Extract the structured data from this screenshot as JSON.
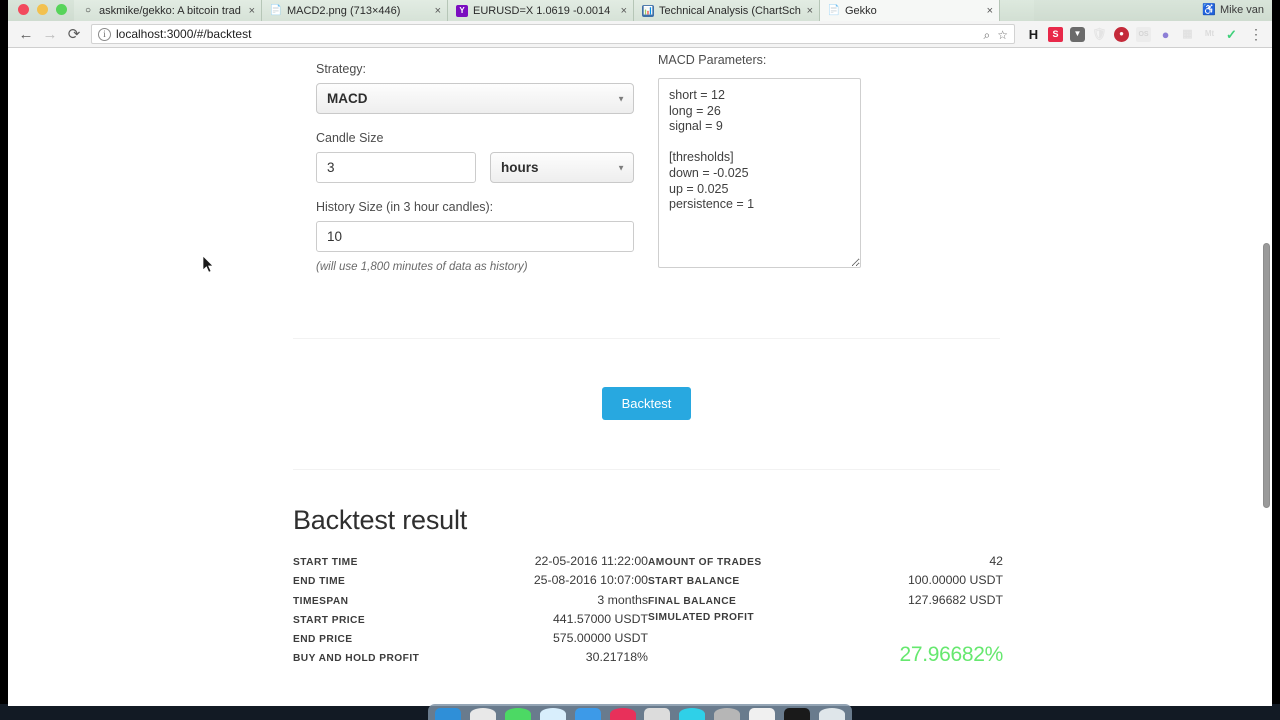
{
  "browser": {
    "window_controls": [
      "close",
      "minimize",
      "zoom"
    ],
    "tabs": [
      {
        "title": "askmike/gekko: A bitcoin trad",
        "favicon": "github-icon",
        "active": false,
        "close_label": "×"
      },
      {
        "title": "MACD2.png (713×446)",
        "favicon": "file-icon",
        "active": false,
        "close_label": "×"
      },
      {
        "title": "EURUSD=X 1.0619 -0.0014",
        "favicon": "yahoo-icon",
        "active": false,
        "close_label": "×"
      },
      {
        "title": "Technical Analysis (ChartScho",
        "favicon": "chart-icon",
        "active": false,
        "close_label": "×"
      },
      {
        "title": "Gekko",
        "favicon": "file-icon",
        "active": true,
        "close_label": "×"
      }
    ],
    "new_tab_label": "+",
    "user": {
      "name": "Mike van",
      "icon": "user-badge-icon"
    },
    "nav": {
      "back": "←",
      "forward": "→",
      "reload": "⟳"
    },
    "omnibox": {
      "info_icon": "i",
      "url": "localhost:3000/#/backtest",
      "zoom_icon": "⌕",
      "bookmark_icon": "☆"
    },
    "extensions": [
      {
        "name": "honey-extension",
        "glyph": "H",
        "color": "#1c1c1c",
        "bg": "transparent",
        "faded": false
      },
      {
        "name": "stylish-extension",
        "glyph": "S",
        "color": "#ffffff",
        "bg": "#e8294a",
        "faded": false
      },
      {
        "name": "pocket-extension",
        "glyph": "▼",
        "color": "#ffffff",
        "bg": "#6b6b6b",
        "faded": false
      },
      {
        "name": "shield-extension",
        "glyph": "⬡",
        "color": "#c9c9c9",
        "bg": "transparent",
        "faded": true
      },
      {
        "name": "adblock-extension",
        "glyph": "●",
        "color": "#ffffff",
        "bg": "#c42a3a",
        "faded": false
      },
      {
        "name": "os-extension",
        "glyph": "OS",
        "color": "#a8a8a8",
        "bg": "#e0e0e0",
        "faded": true
      },
      {
        "name": "orb-extension",
        "glyph": "●",
        "color": "#8d7fd6",
        "bg": "transparent",
        "faded": false
      },
      {
        "name": "qr-extension",
        "glyph": "▦",
        "color": "#c0c0c0",
        "bg": "transparent",
        "faded": true
      },
      {
        "name": "mt-extension",
        "glyph": "Mt",
        "color": "#b0b0b0",
        "bg": "transparent",
        "faded": true
      },
      {
        "name": "grammarly-extension",
        "glyph": "✔",
        "color": "#3fd07a",
        "bg": "transparent",
        "faded": false
      }
    ],
    "menu_icon": "⋮"
  },
  "form": {
    "strategy_label": "Strategy:",
    "strategy_value": "MACD",
    "strategy_options": [
      "MACD"
    ],
    "candle_size_label": "Candle Size",
    "candle_size_value": "3",
    "candle_unit_value": "hours",
    "candle_unit_options": [
      "hours"
    ],
    "history_label": "History Size (in 3 hour candles):",
    "history_value": "10",
    "history_hint": "(will use 1,800 minutes of data as history)",
    "params_label": "MACD Parameters:",
    "params_value": "short = 12\nlong = 26\nsignal = 9\n\n[thresholds]\ndown = -0.025\nup = 0.025\npersistence = 1",
    "backtest_button": "Backtest",
    "accent_color": "#28a8e0"
  },
  "results": {
    "heading": "Backtest result",
    "left": [
      {
        "key": "START TIME",
        "value": "22-05-2016 11:22:00"
      },
      {
        "key": "END TIME",
        "value": "25-08-2016 10:07:00"
      },
      {
        "key": "TIMESPAN",
        "value": "3 months"
      },
      {
        "key": "START PRICE",
        "value": "441.57000 USDT"
      },
      {
        "key": "END PRICE",
        "value": "575.00000 USDT"
      },
      {
        "key": "BUY AND HOLD PROFIT",
        "value": "30.21718%"
      }
    ],
    "right": [
      {
        "key": "AMOUNT OF TRADES",
        "value": "42"
      },
      {
        "key": "START BALANCE",
        "value": "100.00000 USDT"
      },
      {
        "key": "FINAL BALANCE",
        "value": "127.96682 USDT"
      },
      {
        "key": "SIMULATED PROFIT",
        "value": ""
      }
    ],
    "profit": "27.96682%",
    "profit_color": "#66e86f"
  },
  "dock": {
    "icons": [
      {
        "name": "finder-icon",
        "color": "#2f8fd8"
      },
      {
        "name": "siri-icon",
        "color": "#e8e8e8"
      },
      {
        "name": "messages-icon",
        "color": "#4cd964"
      },
      {
        "name": "safari-icon",
        "color": "#d8eefc"
      },
      {
        "name": "mail-icon",
        "color": "#3d9ae8"
      },
      {
        "name": "music-icon",
        "color": "#e8305a"
      },
      {
        "name": "calendar-icon",
        "color": "#dcdcdc"
      },
      {
        "name": "photos-icon",
        "color": "#2fd0e8"
      },
      {
        "name": "terminal-icon",
        "color": "#b6b6b6"
      },
      {
        "name": "notes-icon",
        "color": "#f0f0f0"
      },
      {
        "name": "slack-icon",
        "color": "#1a1a1a"
      },
      {
        "name": "chrome-icon",
        "color": "#dfe6ea"
      }
    ]
  }
}
